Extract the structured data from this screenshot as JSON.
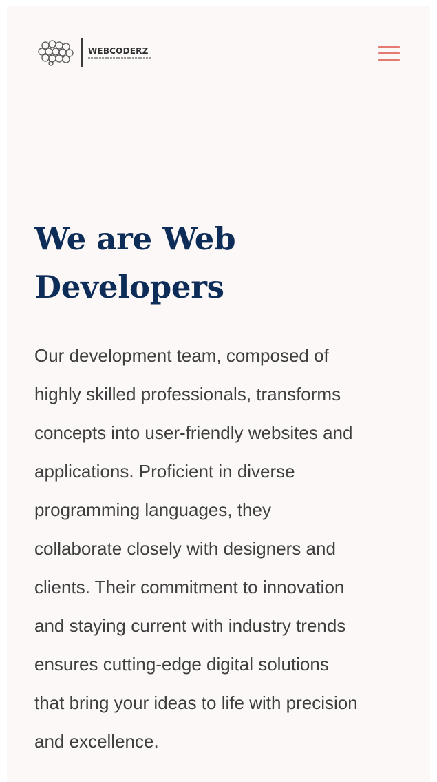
{
  "header": {
    "logo": {
      "name": "WEBCODERZ",
      "icon": "honeycomb-logo-icon"
    },
    "menu_icon": "hamburger-menu-icon",
    "accent_color": "#e57a70"
  },
  "hero": {
    "title_line1": "We are Web",
    "title_line2": "Developers",
    "body_lines": [
      "Our development team, composed of",
      "highly skilled professionals, transforms",
      "concepts into user-friendly websites and",
      "applications. Proficient in diverse",
      "programming languages, they",
      "collaborate closely with designers and",
      "clients. Their commitment to innovation",
      "and staying current with industry trends",
      "ensures cutting-edge digital solutions",
      "that bring your ideas to life with precision",
      "and excellence."
    ],
    "title_color": "#0d2c57"
  }
}
